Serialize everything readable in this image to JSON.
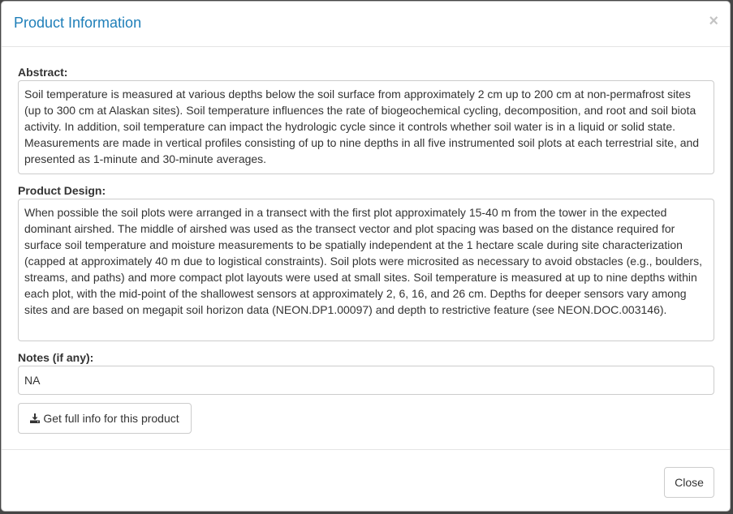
{
  "modal": {
    "title": "Product Information",
    "close_symbol": "×"
  },
  "abstract": {
    "label": "Abstract:",
    "text": "Soil temperature is measured at various depths below the soil surface from approximately 2 cm up to 200 cm at non-permafrost sites (up to 300 cm at Alaskan sites). Soil temperature influences the rate of biogeochemical cycling, decomposition, and root and soil biota activity. In addition, soil temperature can impact the hydrologic cycle since it controls whether soil water is in a liquid or solid state. Measurements are made in vertical profiles consisting of up to nine depths in all five instrumented soil plots at each terrestrial site, and presented as 1-minute and 30-minute averages."
  },
  "design": {
    "label": "Product Design:",
    "text": "When possible the soil plots were arranged in a transect with the first plot approximately 15-40 m from the tower in the expected dominant airshed. The middle of airshed was used as the transect vector and plot spacing was based on the distance required for surface soil temperature and moisture measurements to be spatially independent at the 1 hectare scale during site characterization (capped at approximately 40 m due to logistical constraints). Soil plots were microsited as necessary to avoid obstacles (e.g., boulders, streams, and paths) and more compact plot layouts were used at small sites. Soil temperature is measured at up to nine depths within each plot, with the mid-point of the shallowest sensors at approximately 2, 6, 16, and 26 cm. Depths for deeper sensors vary among sites and are based on megapit soil horizon data (NEON.DP1.00097) and depth to restrictive feature (see NEON.DOC.003146)."
  },
  "notes": {
    "label": "Notes (if any):",
    "value": "NA"
  },
  "actions": {
    "full_info_label": "Get full info for this product",
    "full_info_icon": "download-icon",
    "close_label": "Close"
  }
}
